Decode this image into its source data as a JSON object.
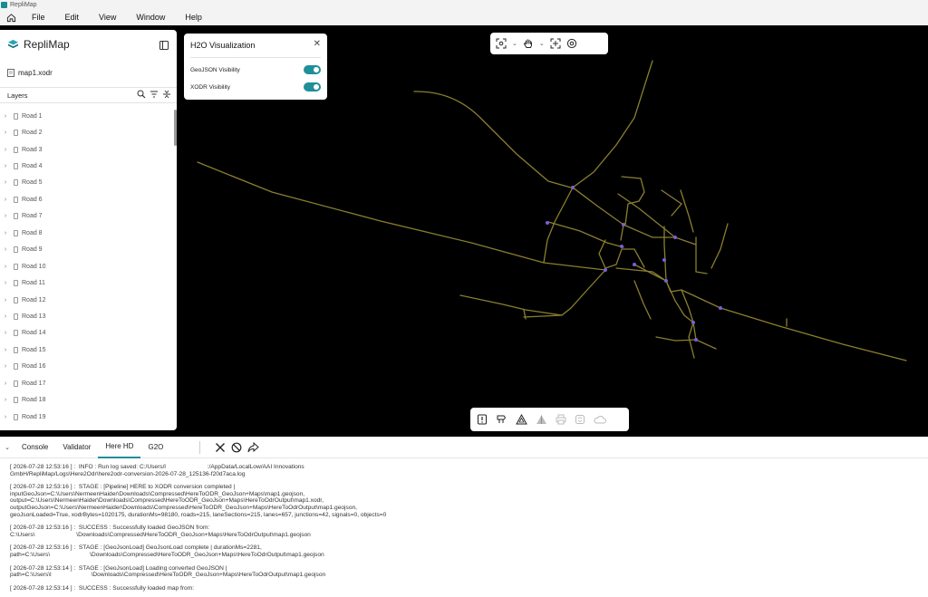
{
  "titlebar": {
    "app_name": "RepliMap"
  },
  "menu": {
    "items": [
      "File",
      "Edit",
      "View",
      "Window",
      "Help"
    ]
  },
  "sidebar": {
    "brand": "RepliMap",
    "file_name": "map1.xodr",
    "layers_label": "Layers",
    "roads": [
      "Road 1",
      "Road 2",
      "Road 3",
      "Road 4",
      "Road 5",
      "Road 6",
      "Road 7",
      "Road 8",
      "Road 9",
      "Road 10",
      "Road 11",
      "Road 12",
      "Road 13",
      "Road 14",
      "Road 15",
      "Road 16",
      "Road 17",
      "Road 18",
      "Road 19"
    ]
  },
  "h2o_panel": {
    "title": "H2O Visualization",
    "geojson_label": "GeoJSON Visibility",
    "geojson_on": true,
    "xodr_label": "XODR Visibility",
    "xodr_on": true
  },
  "colors": {
    "accent": "#1f8f99",
    "road": "#8a7f2e",
    "junction": "#7b5fd6"
  },
  "console": {
    "tabs": [
      "Console",
      "Validator",
      "Here HD",
      "G2O"
    ],
    "active_tab": "Here HD",
    "logs": [
      "[ 2026-07-28 12:53:16 ] :  INFO : Run log saved: C:/Users/l                         :/AppData/LocalLow/AAI Innovations\nGmbH/RepliMap/Logs\\Here2Odr\\here2odr-conversion-2026-07-28_125136-f20d7aca.log",
      "[ 2026-07-28 12:53:16 ] :  STAGE : [Pipeline] HERE to XODR conversion completed |\ninputGeoJson=C:\\Users\\NermeenHaider\\Downloads\\Compressed\\HereToODR_GeoJson+Maps\\map1.geojson,\noutput=C:\\Users\\NermeenHaider\\Downloads\\Compressed\\HereToODR_GeoJson+Maps\\HereToOdrOutput\\map1.xodr,\noutputGeoJson=C:\\Users\\NermeenHaider\\Downloads\\Compressed\\HereToODR_GeoJson+Maps\\HereToOdrOutput\\map1.geojson,\ngeoJsonLoaded=True, xodrBytes=1020175, durationMs=98180, roads=215, laneSections=215, lanes=657, junctions=42, signals=0, objects=0",
      "[ 2026-07-28 12:53:16 ] :  SUCCESS : Successfully loaded GeoJSON from:\nC:\\Users\\                         \\Downloads\\Compressed\\HereToODR_GeoJson+Maps\\HereToOdrOutput\\map1.geojson",
      "[ 2026-07-28 12:53:16 ] :  STAGE : [GeoJsonLoad] GeoJsonLoad complete | durationMs=2281,\npath=C:\\Users\\                        \\Downloads\\Compressed\\HereToODR_GeoJson+Maps\\HereToOdrOutput\\map1.geojson",
      "[ 2026-07-28 12:53:14 ] :  STAGE : [GeoJsonLoad] Loading converted GeoJSON |\npath=C:\\Users\\l                        \\Downloads\\Compressed\\HereToODR_GeoJson+Maps\\HereToOdrOutput\\map1.geojson",
      "[ 2026-07-28 12:53:14 ] :  SUCCESS : Successfully loaded map from:"
    ]
  }
}
